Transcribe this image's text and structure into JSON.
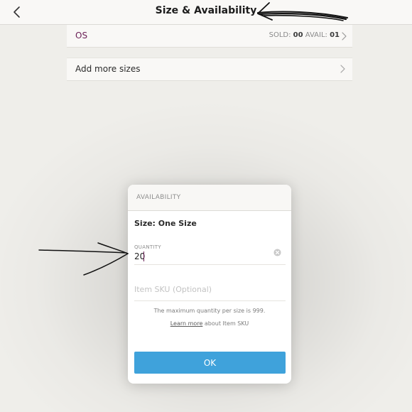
{
  "header": {
    "title": "Size & Availability"
  },
  "size_row": {
    "code": "OS",
    "sold_label": "SOLD:",
    "sold_value": "00",
    "avail_label": "AVAIL:",
    "avail_value": "01"
  },
  "add_sizes": {
    "label": "Add more sizes"
  },
  "modal": {
    "header": "AVAILABILITY",
    "size_label": "Size: One Size",
    "quantity_label": "QUANTITY",
    "quantity_value": "20",
    "sku_placeholder": "Item SKU (Optional)",
    "max_note": "The maximum quantity per size is 999.",
    "learn_more_link": "Learn more",
    "learn_more_suffix": " about Item SKU",
    "ok_label": "OK"
  },
  "colors": {
    "accent_purple": "#6a1e55",
    "ok_blue": "#3fa2db"
  }
}
